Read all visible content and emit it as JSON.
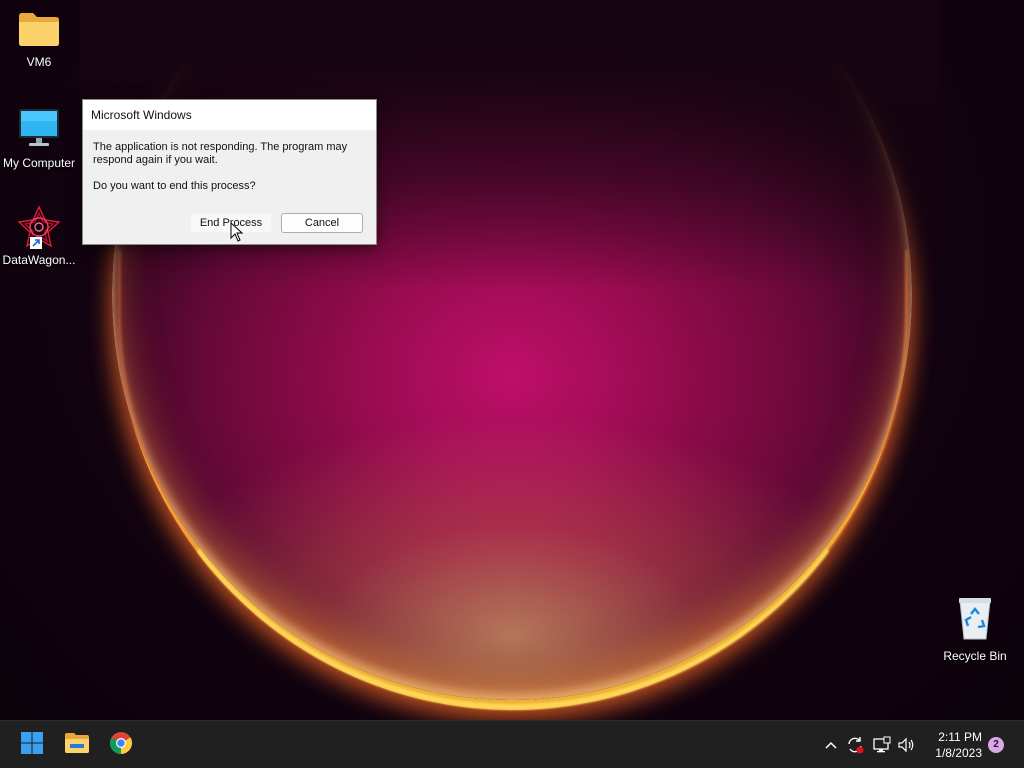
{
  "desktop": {
    "icons": [
      {
        "label": "VM6",
        "icon": "folder-icon"
      },
      {
        "label": "My Computer",
        "icon": "monitor-icon"
      },
      {
        "label": "DataWagon...",
        "icon": "datawagon-app-icon"
      },
      {
        "label": "Recycle Bin",
        "icon": "recycle-bin-icon"
      }
    ]
  },
  "dialog": {
    "title": "Microsoft Windows",
    "message": "The application is not responding. The program may respond again if you wait.",
    "question": "Do you want to end this process?",
    "end_process_label": "End Process",
    "cancel_label": "Cancel"
  },
  "taskbar": {
    "apps": [
      {
        "name": "Start",
        "icon": "windows-start-icon"
      },
      {
        "name": "File Explorer",
        "icon": "file-explorer-icon"
      },
      {
        "name": "Google Chrome",
        "icon": "chrome-icon"
      }
    ],
    "tray": {
      "icons": [
        "chevron-up-icon",
        "sync-icon",
        "network-icon",
        "volume-icon"
      ],
      "time": "2:11 PM",
      "date": "1/8/2023",
      "notification_count": "2"
    }
  },
  "colors": {
    "taskbar_bg": "#202020",
    "dialog_bg": "#f0f0f0",
    "accent": "#0078d4",
    "notification_badge": "#d9a8e8"
  }
}
